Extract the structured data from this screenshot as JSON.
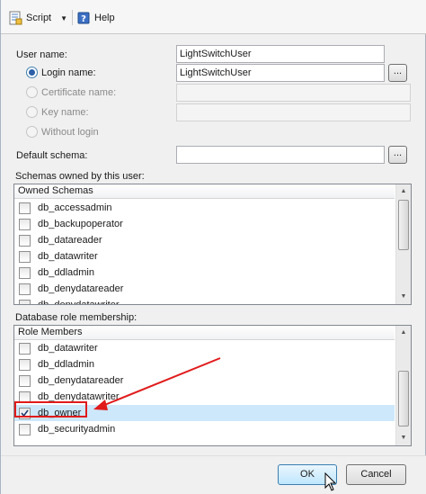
{
  "toolbar": {
    "script_label": "Script",
    "help_label": "Help"
  },
  "form": {
    "user_name_label": "User name:",
    "user_name_value": "LightSwitchUser",
    "login_name_label": "Login name:",
    "login_name_value": "LightSwitchUser",
    "certificate_name_label": "Certificate name:",
    "key_name_label": "Key name:",
    "without_login_label": "Without login",
    "default_schema_label": "Default schema:",
    "browse_label": "..."
  },
  "schemas": {
    "section_label": "Schemas owned by this user:",
    "header": "Owned Schemas",
    "items": [
      {
        "label": "db_accessadmin",
        "checked": false
      },
      {
        "label": "db_backupoperator",
        "checked": false
      },
      {
        "label": "db_datareader",
        "checked": false
      },
      {
        "label": "db_datawriter",
        "checked": false
      },
      {
        "label": "db_ddladmin",
        "checked": false
      },
      {
        "label": "db_denydatareader",
        "checked": false
      },
      {
        "label": "db_denydatawriter",
        "checked": false
      }
    ]
  },
  "roles": {
    "section_label": "Database role membership:",
    "header": "Role Members",
    "items": [
      {
        "label": "db_datawriter",
        "checked": false
      },
      {
        "label": "db_ddladmin",
        "checked": false
      },
      {
        "label": "db_denydatareader",
        "checked": false
      },
      {
        "label": "db_denydatawriter",
        "checked": false
      },
      {
        "label": "db_owner",
        "checked": true
      },
      {
        "label": "db_securityadmin",
        "checked": false
      }
    ]
  },
  "buttons": {
    "ok_label": "OK",
    "cancel_label": "Cancel"
  },
  "colors": {
    "selection": "#cde8fb",
    "annotation_red": "#e01b1b"
  }
}
